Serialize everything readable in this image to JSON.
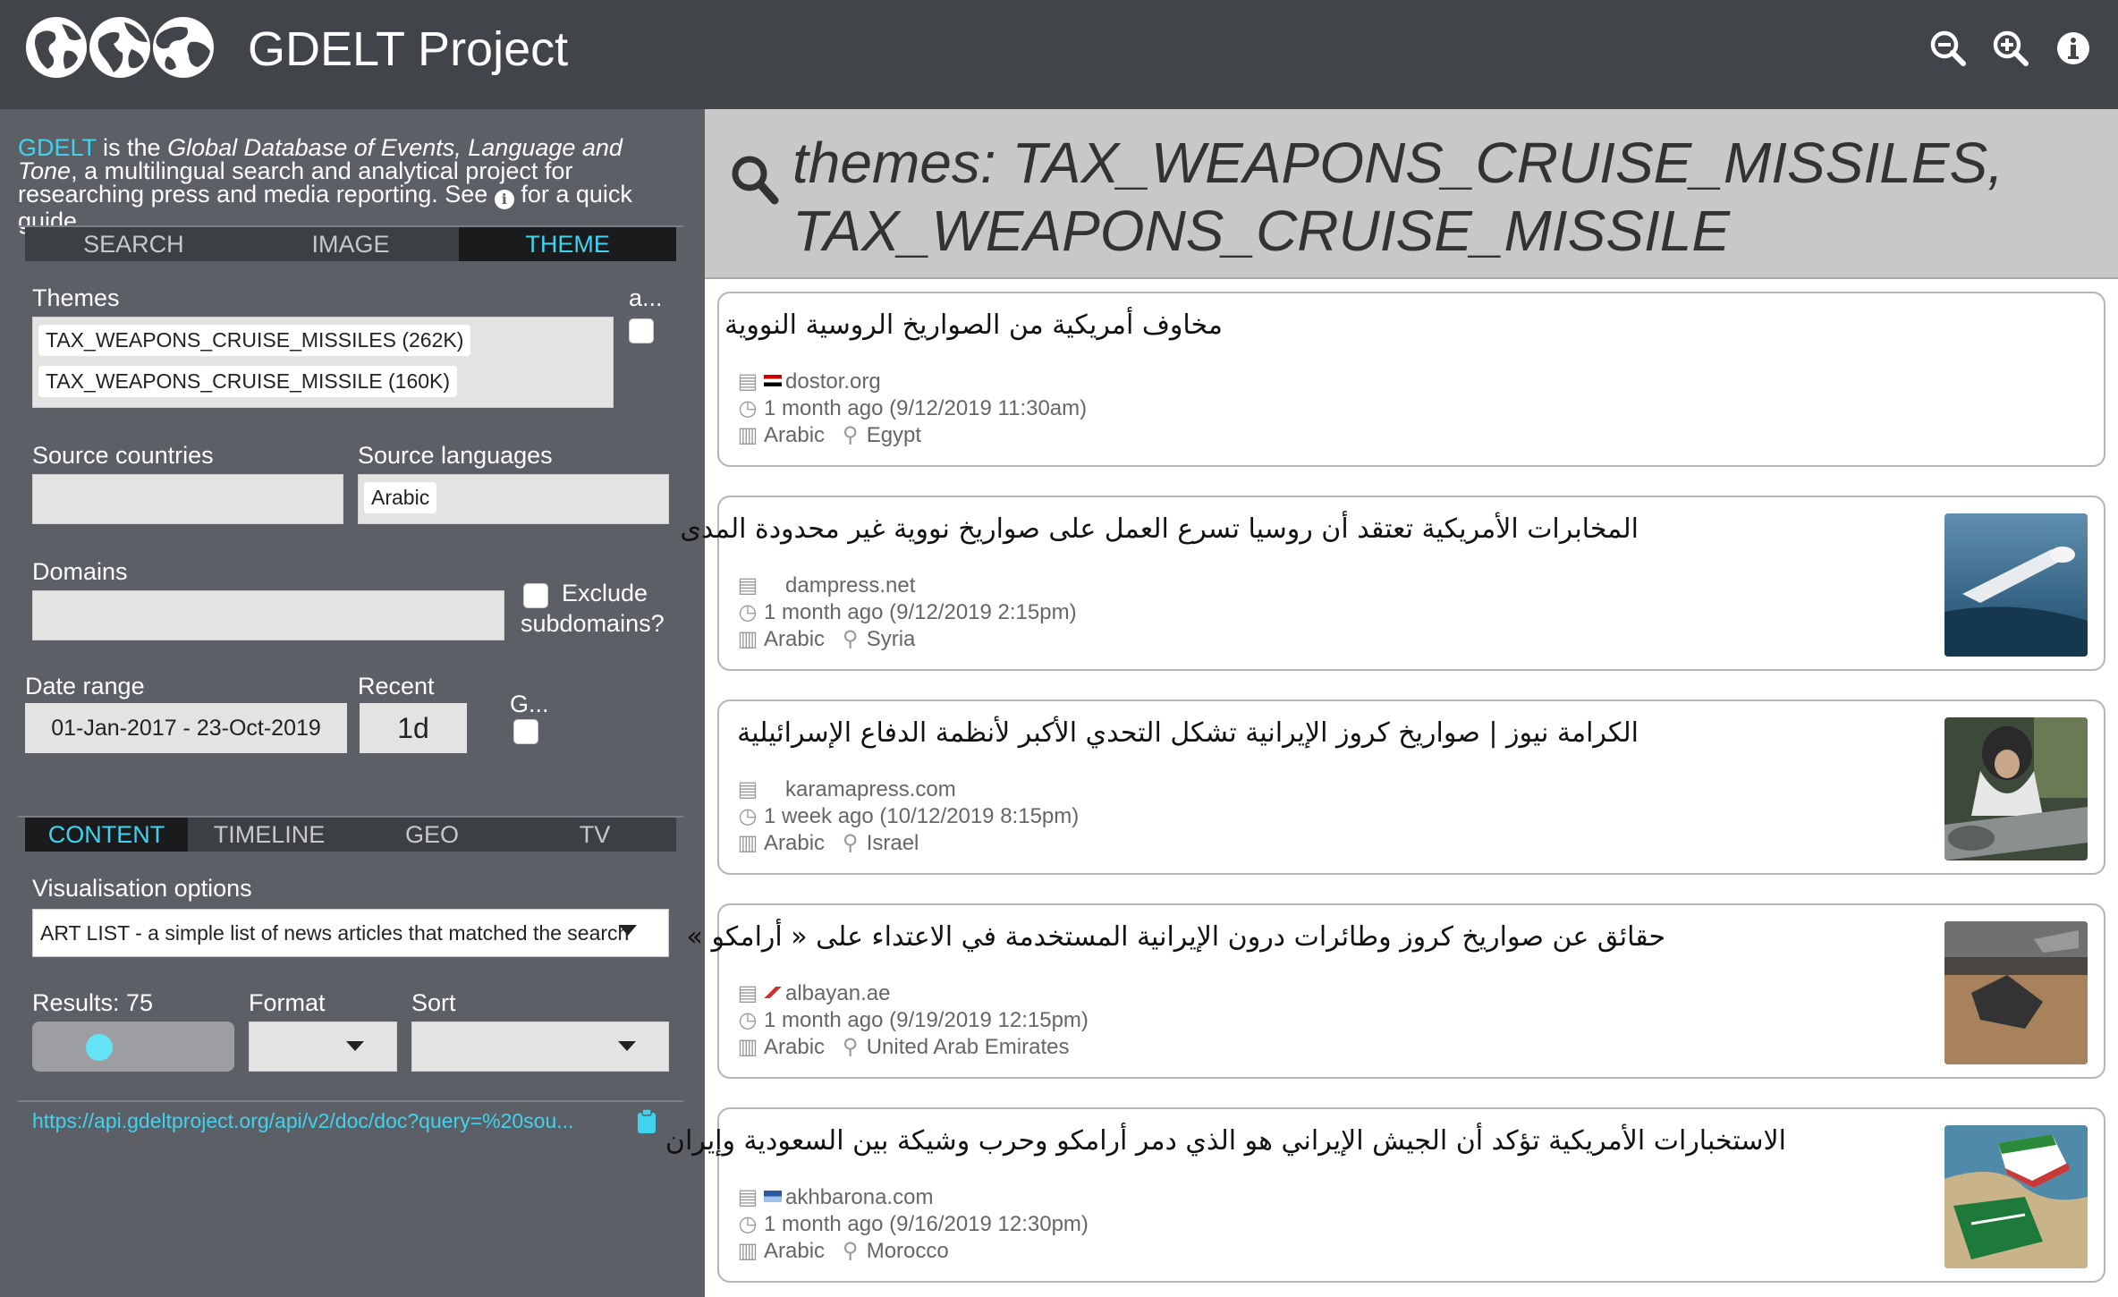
{
  "header": {
    "title": "GDELT Project",
    "icons": [
      "globe-icon",
      "globe-icon",
      "globe-icon",
      "zoom-out-icon",
      "zoom-in-icon",
      "info-icon"
    ]
  },
  "sidebar": {
    "intro": {
      "brand": "GDELT",
      "t1": " is the ",
      "italic": "Global Database of Events, Language and Tone",
      "t2": ", a multilingual search and analytical project for researching press and media reporting. See ",
      "info": "i",
      "t3": " for a quick guide."
    },
    "tabs1": [
      {
        "label": "SEARCH"
      },
      {
        "label": "IMAGE"
      },
      {
        "label": "THEME"
      }
    ],
    "themes_label": "Themes",
    "themes_chips": [
      "TAX_WEAPONS_CRUISE_MISSILES (262K)",
      "TAX_WEAPONS_CRUISE_MISSILE (160K)"
    ],
    "all_label": "a...",
    "source_countries_label": "Source countries",
    "source_languages_label": "Source languages",
    "source_language_chip": "Arabic",
    "domains_label": "Domains",
    "exclude_label_1": "Exclude",
    "exclude_label_2": "subdomains?",
    "date_range_label": "Date range",
    "date_range_value": "01-Jan-2017 - 23-Oct-2019",
    "recent_label": "Recent",
    "recent_value": "1d",
    "g_label": "G...",
    "tabs2": [
      {
        "label": "CONTENT"
      },
      {
        "label": "TIMELINE"
      },
      {
        "label": "GEO"
      },
      {
        "label": "TV"
      }
    ],
    "vis_label": "Visualisation options",
    "vis_value": "ART LIST - a simple list of news articles that matched the search",
    "results_label": "Results: 75",
    "results_value": 75,
    "format_label": "Format",
    "sort_label": "Sort",
    "api_url": "https://api.gdeltproject.org/api/v2/doc/doc?query=%20sou..."
  },
  "query": {
    "text": "themes: TAX_WEAPONS_CRUISE_MISSILES, TAX_WEAPONS_CRUISE_MISSILE"
  },
  "articles": [
    {
      "title": "مخاوف أمريكية من الصواريخ الروسية النووية",
      "domain": "dostor.org",
      "time": "1 month ago (9/12/2019 11:30am)",
      "language": "Arabic",
      "country": "Egypt"
    },
    {
      "title": "المخابرات الأمريكية تعتقد أن روسيا تسرع العمل على صواريخ نووية غير محدودة المدى",
      "domain": "dampress.net",
      "time": "1 month ago (9/12/2019 2:15pm)",
      "language": "Arabic",
      "country": "Syria"
    },
    {
      "title": "الكرامة نيوز | صواريخ كروز الإيرانية تشكل التحدي الأكبر لأنظمة الدفاع الإسرائيلية",
      "domain": "karamapress.com",
      "time": "1 week ago (10/12/2019 8:15pm)",
      "language": "Arabic",
      "country": "Israel"
    },
    {
      "title": "حقائق عن صواريخ كروز وطائرات درون الإيرانية المستخدمة في الاعتداء على « أرامكو »",
      "domain": "albayan.ae",
      "time": "1 month ago (9/19/2019 12:15pm)",
      "language": "Arabic",
      "country": "United Arab Emirates"
    },
    {
      "title": "الاستخبارات الأمريكية تؤكد أن الجيش الإيراني هو الذي دمر أرامكو وحرب وشيكة بين السعودية وإيران",
      "domain": "akhbarona.com",
      "time": "1 month ago (9/16/2019 12:30pm)",
      "language": "Arabic",
      "country": "Morocco"
    }
  ],
  "colors": {
    "accent": "#3fd3f0",
    "header_bg": "#414449",
    "sidebar_bg": "#5c5f66",
    "query_bg": "#c8c8c8"
  }
}
